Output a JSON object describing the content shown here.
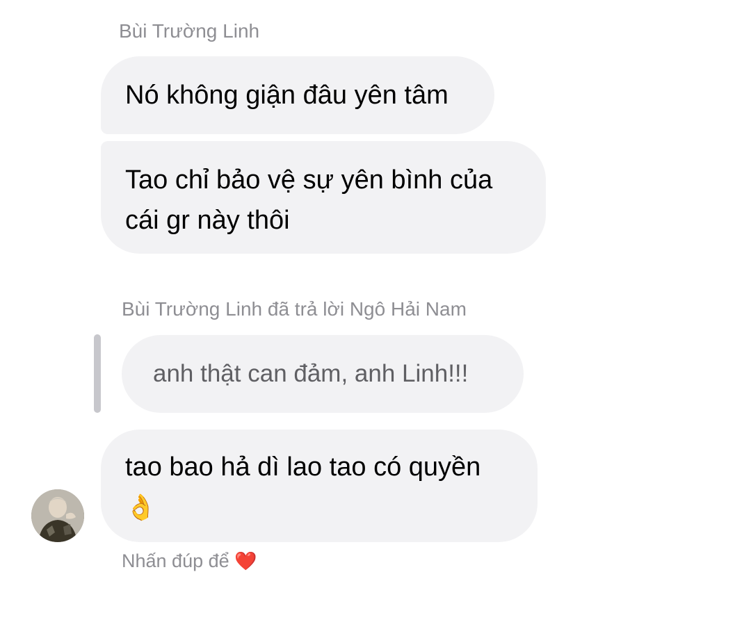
{
  "thread": {
    "sender_name": "Bùi Trường Linh",
    "messages": [
      {
        "text": "Nó không giận đâu yên tâm"
      },
      {
        "text": "Tao chỉ bảo vệ sự yên bình của cái gr này thôi"
      }
    ],
    "reply": {
      "header": "Bùi Trường Linh đã trả lời Ngô Hải Nam",
      "quoted_text": "anh thật can đảm, anh Linh!!!",
      "text": "tao bao hả dì lao tao có quyền",
      "emoji": "👌"
    },
    "hint": {
      "text": "Nhấn đúp để",
      "icon": "heart-icon",
      "icon_glyph": "❤️"
    }
  },
  "colors": {
    "bubble_bg": "#f2f2f4",
    "secondary_text": "#8e8e93",
    "heart": "#e0245e"
  }
}
